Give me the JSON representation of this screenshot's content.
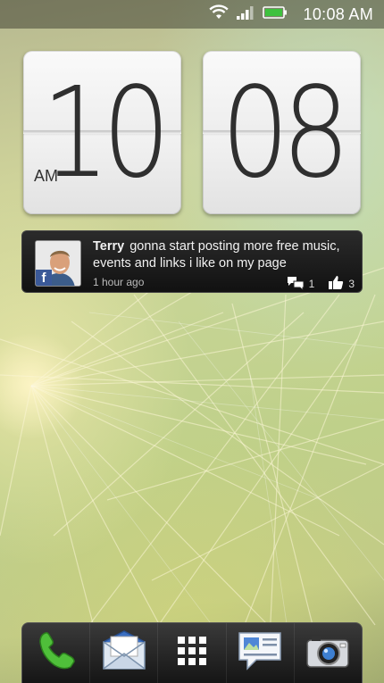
{
  "status_bar": {
    "time": "10:08 AM",
    "icons": [
      "wifi-icon",
      "signal-icon",
      "battery-icon"
    ],
    "battery_color": "#3ec13e"
  },
  "clock": {
    "hours": "10",
    "minutes": "08",
    "ampm": "AM"
  },
  "feed": {
    "author": "Terry",
    "message": "gonna start  posting more free music, events and links i like on my page",
    "time_ago": "1 hour ago",
    "comments": "1",
    "likes": "3",
    "source_icon": "facebook-icon"
  },
  "dock": {
    "apps": [
      "phone-icon",
      "mail-icon",
      "all-apps-icon",
      "messages-icon",
      "camera-icon"
    ]
  },
  "colors": {
    "facebook": "#3b5998",
    "phone_green": "#4fbf3a"
  }
}
